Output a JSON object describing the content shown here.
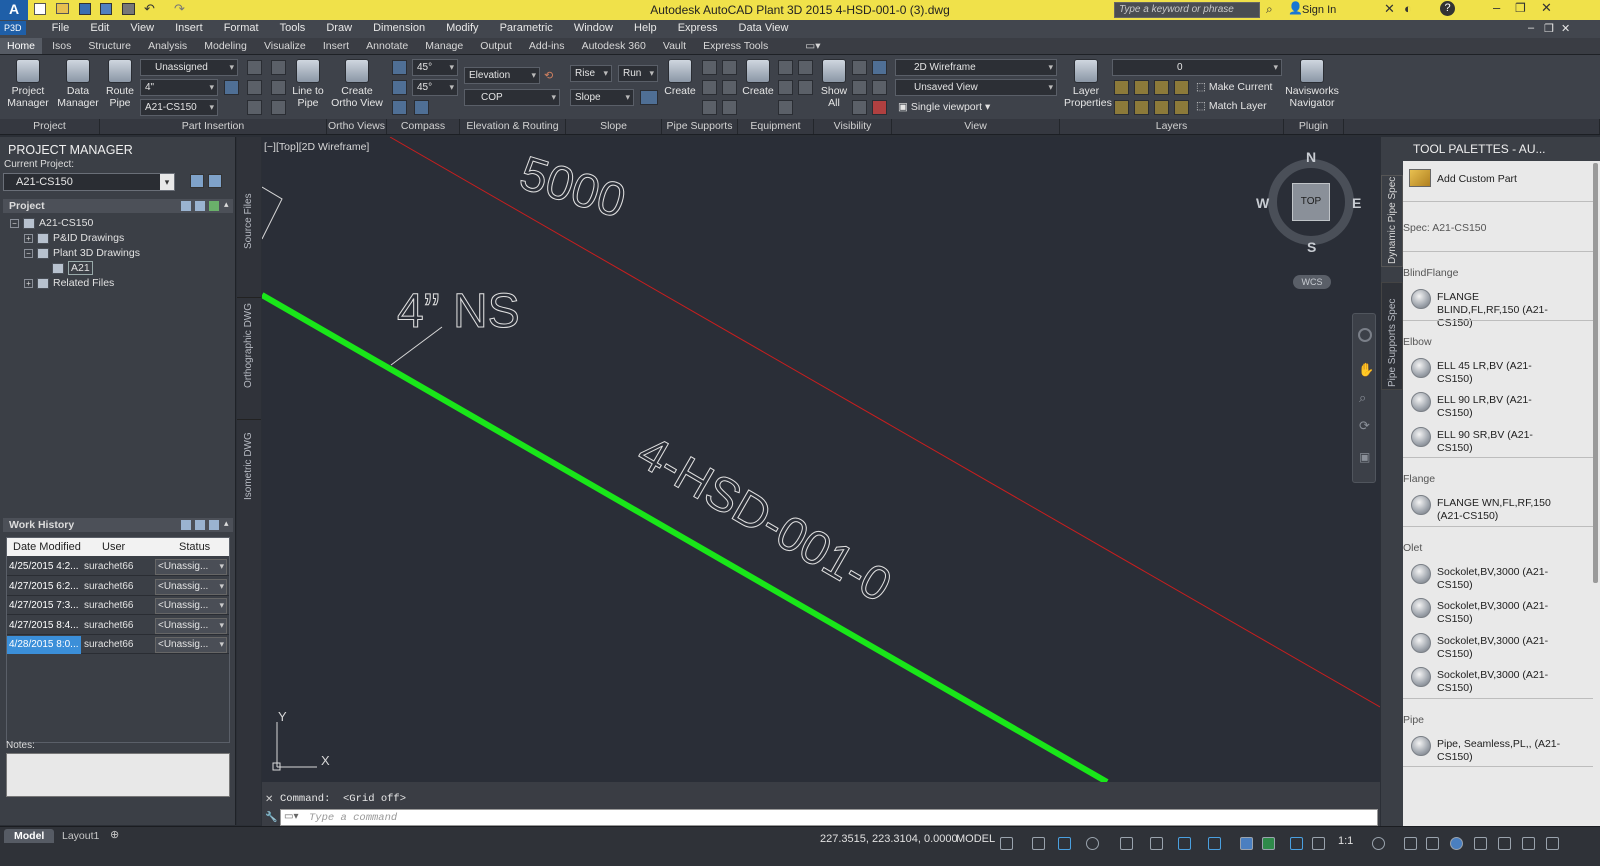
{
  "window": {
    "title": "Autodesk AutoCAD Plant 3D 2015    4-HSD-001-0 (3).dwg",
    "app_badge": "P3D",
    "search_placeholder": "Type a keyword or phrase",
    "sign_in": "Sign In"
  },
  "menu": [
    "File",
    "Edit",
    "View",
    "Insert",
    "Format",
    "Tools",
    "Draw",
    "Dimension",
    "Modify",
    "Parametric",
    "Window",
    "Help",
    "Express",
    "Data View"
  ],
  "tabs": [
    "Home",
    "Isos",
    "Structure",
    "Analysis",
    "Modeling",
    "Visualize",
    "Insert",
    "Annotate",
    "Manage",
    "Output",
    "Add-ins",
    "Autodesk 360",
    "Vault",
    "Express Tools"
  ],
  "ribbon": {
    "project_manager": "Project\nManager",
    "data_manager": "Data\nManager",
    "route_pipe": "Route\nPipe",
    "line_to_pipe": "Line to\nPipe",
    "create_ortho": "Create\nOrtho View",
    "combo_unassigned": "Unassigned",
    "combo_size": "4\"",
    "combo_spec": "A21-CS150",
    "angle1": "45°",
    "angle2": "45°",
    "elevation": "Elevation",
    "cop": "COP",
    "rise": "Rise",
    "run": "Run",
    "slope": "Slope",
    "create1": "Create",
    "create2": "Create",
    "show_all": "Show\nAll",
    "visual_style": "2D Wireframe",
    "saved_view": "Unsaved View",
    "viewport": "Single viewport",
    "layer_props": "Layer\nProperties",
    "layer_combo": "0",
    "make_current": "Make Current",
    "match_layer": "Match Layer",
    "navisworks": "Navisworks\nNavigator",
    "panels": [
      "Project",
      "Part Insertion",
      "Ortho Views",
      "Compass",
      "Elevation & Routing",
      "Slope",
      "Pipe Supports",
      "Equipment",
      "Visibility",
      "View",
      "Layers",
      "Plugin"
    ]
  },
  "project_manager": {
    "header": "PROJECT MANAGER",
    "current_project_label": "Current Project:",
    "current_project": "A21-CS150",
    "project_label": "Project",
    "tree": [
      "A21-CS150",
      "P&ID Drawings",
      "Plant 3D Drawings",
      "A21",
      "Related Files"
    ],
    "work_history_label": "Work History",
    "columns": [
      "Date Modified",
      "User",
      "Status"
    ],
    "rows": [
      [
        "4/25/2015 4:2...",
        "surachet66",
        "<Unassig..."
      ],
      [
        "4/27/2015 6:2...",
        "surachet66",
        "<Unassig..."
      ],
      [
        "4/27/2015 7:3...",
        "surachet66",
        "<Unassig..."
      ],
      [
        "4/27/2015 8:4...",
        "surachet66",
        "<Unassig..."
      ],
      [
        "4/28/2015 8:0...",
        "surachet66",
        "<Unassig..."
      ]
    ],
    "notes_label": "Notes:"
  },
  "side_tabs": [
    "Source Files",
    "Orthographic DWG",
    "Isometric DWG"
  ],
  "viewport": {
    "label": "[−][Top][2D Wireframe]",
    "dim_text": "5000",
    "size_text": "4” NS",
    "line_tag": "4-HSD-001-0",
    "compass": {
      "n": "N",
      "s": "S",
      "e": "E",
      "w": "W",
      "top": "TOP",
      "wcs": "WCS"
    },
    "ucs_x": "X",
    "ucs_y": "Y",
    "pipe_color": "#19e619",
    "ref_line_color": "#c81e1e"
  },
  "command": {
    "history": "Command:  <Grid off>",
    "placeholder": "Type a command"
  },
  "tool_palette": {
    "title": "TOOL PALETTES - AU...",
    "vertical_tabs": [
      "Dynamic Pipe Spec",
      "Pipe Supports Spec"
    ],
    "add_custom": "Add Custom Part",
    "spec": "Spec: A21-CS150",
    "groups": [
      {
        "name": "BlindFlange",
        "items": [
          "FLANGE BLIND,FL,RF,150 (A21-CS150)"
        ]
      },
      {
        "name": "Elbow",
        "items": [
          "ELL 45 LR,BV (A21-CS150)",
          "ELL 90 LR,BV (A21-CS150)",
          "ELL 90 SR,BV (A21-CS150)"
        ]
      },
      {
        "name": "Flange",
        "items": [
          "FLANGE WN,FL,RF,150 (A21-CS150)"
        ]
      },
      {
        "name": "Olet",
        "items": [
          "Sockolet,BV,3000 (A21-CS150)",
          "Sockolet,BV,3000 (A21-CS150)",
          "Sockolet,BV,3000 (A21-CS150)",
          "Sockolet,BV,3000 (A21-CS150)"
        ]
      },
      {
        "name": "Pipe",
        "items": [
          "Pipe, Seamless,PL,, (A21-CS150)"
        ]
      }
    ]
  },
  "status": {
    "tabs": [
      "Model",
      "Layout1"
    ],
    "coords": "227.3515, 223.3104, 0.0000",
    "mode": "MODEL",
    "scale": "1:1"
  }
}
